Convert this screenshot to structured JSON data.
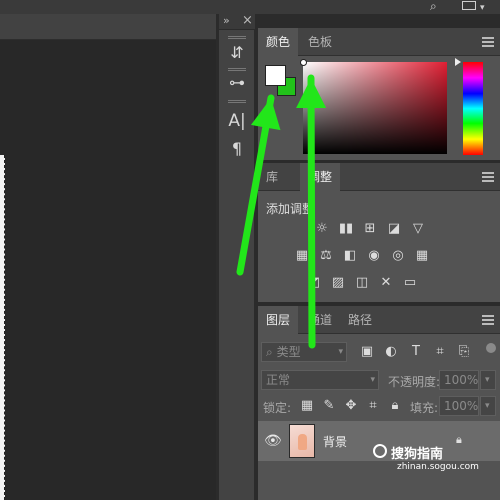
{
  "top_bar": {
    "search_icon": "search-icon",
    "window_icon": "window-icon"
  },
  "tool_column": {
    "collapse_glyph": "»",
    "close_glyph": "×",
    "tools": [
      {
        "name": "history-icon",
        "glyph": "⇵"
      },
      {
        "name": "properties-sliders-icon",
        "glyph": "⊶"
      },
      {
        "name": "character-icon",
        "glyph": "A|"
      },
      {
        "name": "paragraph-icon",
        "glyph": "¶"
      }
    ]
  },
  "color_panel": {
    "tabs": [
      {
        "label": "颜色",
        "active": true
      },
      {
        "label": "色板",
        "active": false
      }
    ],
    "foreground_color": "#ffffff",
    "background_color": "#22c21a"
  },
  "adjust_panel": {
    "tabs": [
      {
        "label": "库",
        "active": false
      },
      {
        "label": "调整",
        "active": true
      }
    ],
    "title": "添加调整",
    "icons": [
      "brightness-contrast-icon",
      "levels-icon",
      "curves-icon",
      "exposure-icon",
      "vibrance-icon",
      "hue-saturation-icon",
      "color-balance-icon",
      "black-white-icon",
      "photo-filter-icon",
      "channel-mixer-icon",
      "color-lookup-icon",
      "invert-icon",
      "posterize-icon",
      "threshold-icon",
      "selective-color-icon",
      "gradient-map-icon"
    ]
  },
  "layers_panel": {
    "tabs": [
      {
        "label": "图层",
        "active": true
      },
      {
        "label": "通道",
        "active": false
      },
      {
        "label": "路径",
        "active": false
      }
    ],
    "filter_placeholder": "类型",
    "blend_mode": "正常",
    "opacity_label": "不透明度:",
    "opacity_value": "100%",
    "lock_label": "锁定:",
    "fill_label": "填充:",
    "fill_value": "100%",
    "layers": [
      {
        "name": "背景",
        "visible": true,
        "locked": true
      }
    ]
  },
  "watermark": {
    "brand": "搜狗指南",
    "url": "zhinan.sogou.com"
  },
  "annotation_color": "#22e61a"
}
